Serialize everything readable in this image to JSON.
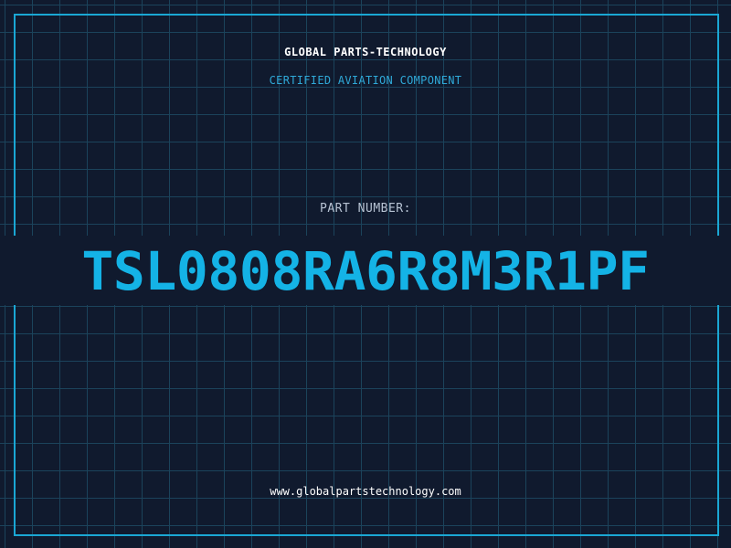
{
  "header": {
    "brand": "GLOBAL PARTS-TECHNOLOGY",
    "subtitle": "CERTIFIED AVIATION COMPONENT"
  },
  "part": {
    "label": "PART NUMBER:",
    "value": "TSL0808RA6R8M3R1PF"
  },
  "footer": {
    "url": "www.globalpartstechnology.com"
  },
  "colors": {
    "background": "#101a2e",
    "grid": "#1d4b63",
    "frame": "#1aa7d4",
    "accent": "#14b3e6",
    "label": "#b7c3d3",
    "text": "#ffffff"
  }
}
